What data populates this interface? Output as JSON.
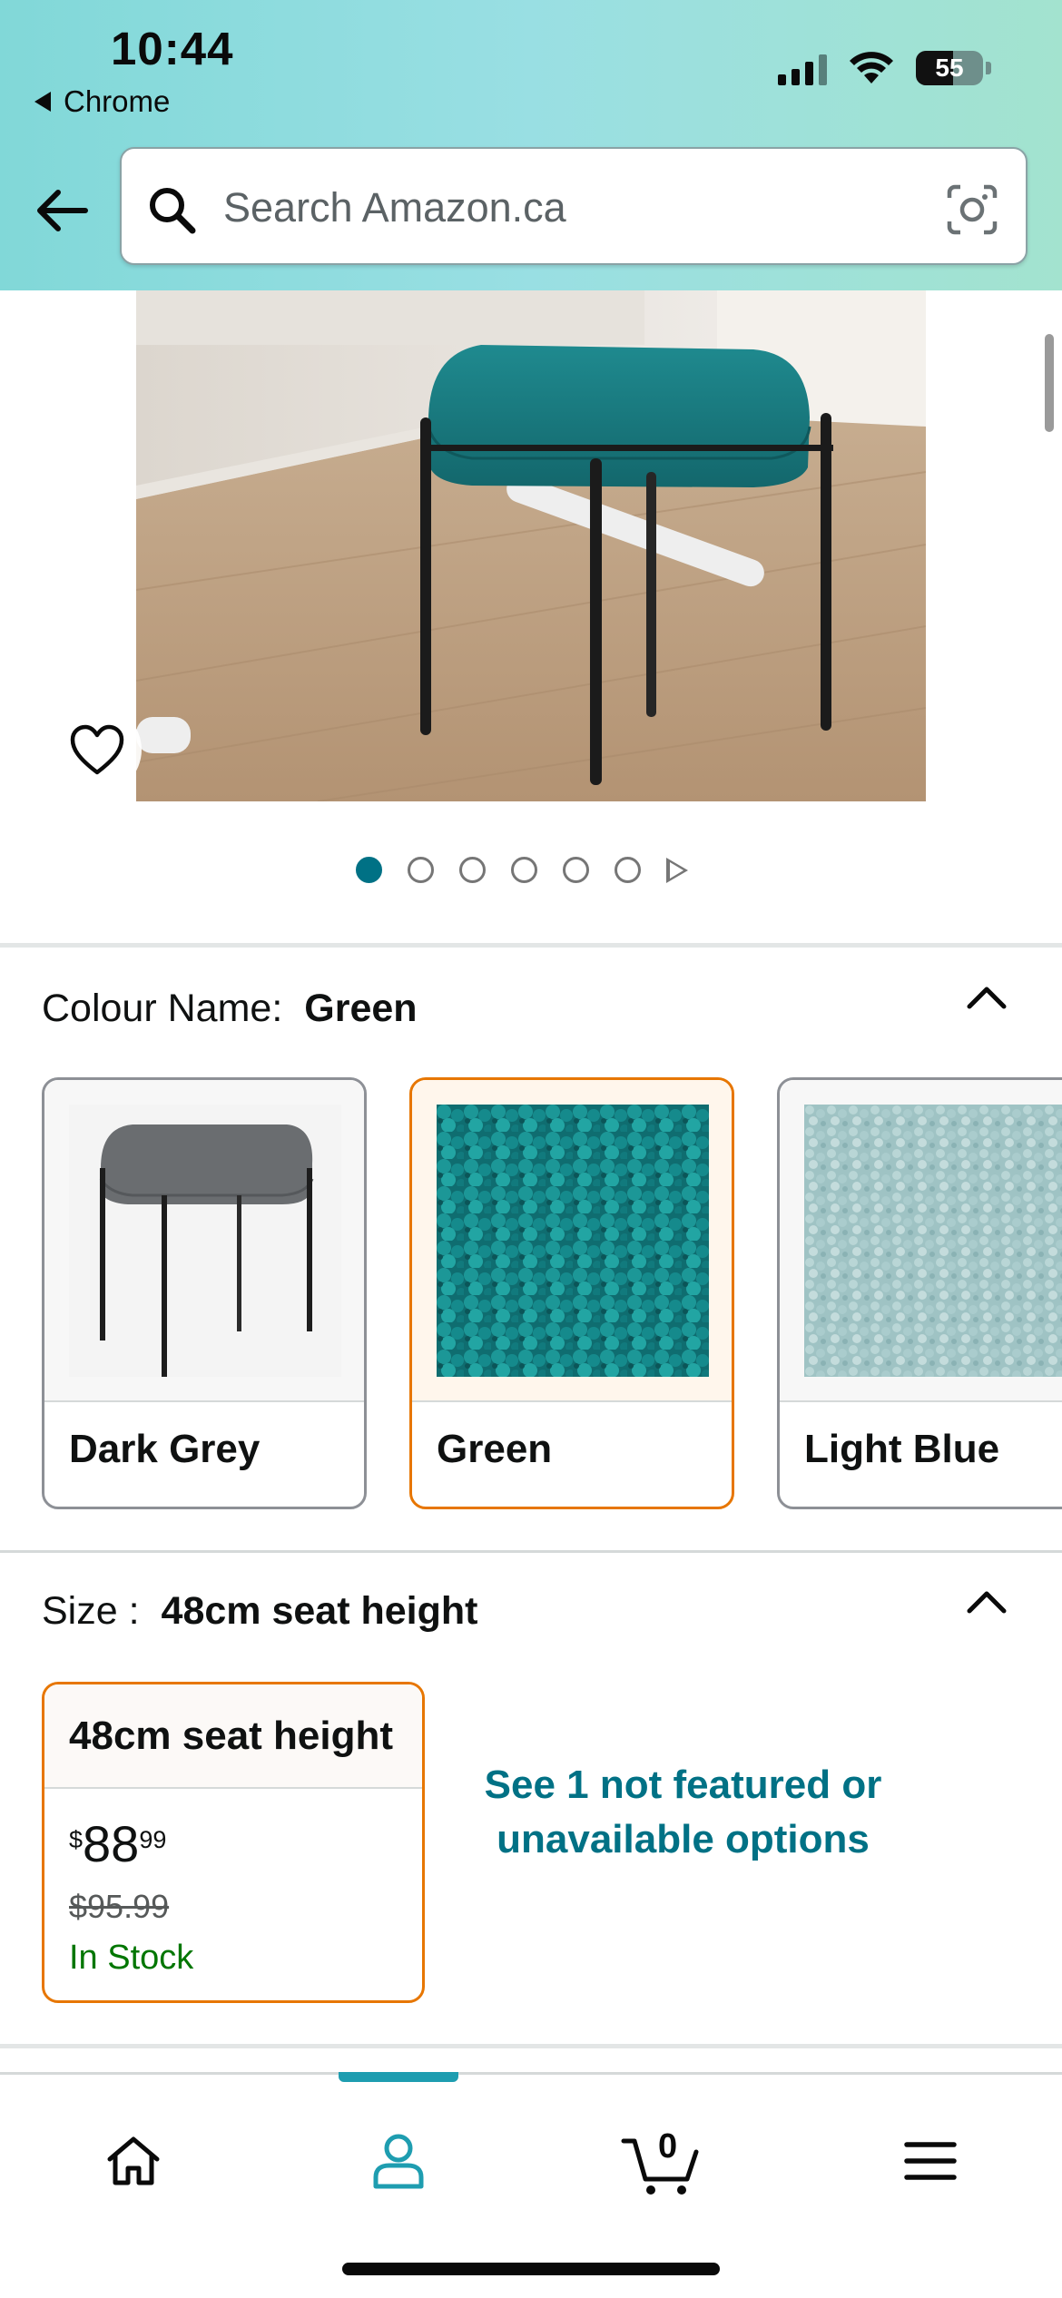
{
  "status_bar": {
    "time": "10:44",
    "back_app": "Chrome",
    "battery": "55"
  },
  "search": {
    "placeholder": "Search Amazon.ca"
  },
  "gallery": {
    "image_count": 6,
    "active_index": 0
  },
  "colour": {
    "label": "Colour Name:",
    "selected": "Green",
    "options": [
      {
        "name": "Dark Grey"
      },
      {
        "name": "Green"
      },
      {
        "name": "Light Blue"
      }
    ]
  },
  "size": {
    "label": "Size :",
    "selected": "48cm seat height",
    "option": {
      "name": "48cm seat height",
      "currency": "$",
      "price_whole": "88",
      "price_fraction": "99",
      "old_price": "$95.99",
      "stock": "In Stock"
    },
    "more_options": "See 1 not featured or unavailable options"
  },
  "bottom_nav": {
    "items": [
      "home",
      "account",
      "cart",
      "menu"
    ],
    "active": "account",
    "cart_count": "0"
  },
  "colors": {
    "accent_teal": "#007185",
    "selected_border": "#e77600",
    "in_stock": "#007600"
  }
}
